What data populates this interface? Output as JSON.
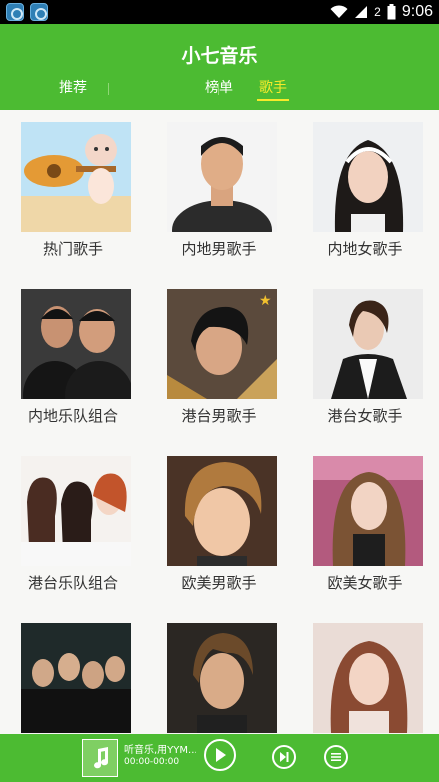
{
  "status_bar": {
    "time": "9:06",
    "signal_badge": "2"
  },
  "app": {
    "title": "小七音乐"
  },
  "tabs": [
    {
      "label": "推荐",
      "active": false
    },
    {
      "label": "榜单",
      "active": false
    },
    {
      "label": "歌手",
      "active": true
    }
  ],
  "categories": [
    {
      "label": "热门歌手"
    },
    {
      "label": "内地男歌手"
    },
    {
      "label": "内地女歌手"
    },
    {
      "label": "内地乐队组合"
    },
    {
      "label": "港台男歌手"
    },
    {
      "label": "港台女歌手"
    },
    {
      "label": "港台乐队组合"
    },
    {
      "label": "欧美男歌手"
    },
    {
      "label": "欧美女歌手"
    },
    {
      "label": ""
    },
    {
      "label": ""
    },
    {
      "label": ""
    }
  ],
  "player": {
    "song_title": "听音乐,用YYM...",
    "time": "00:00-00:00"
  },
  "colors": {
    "accent": "#4cbb32",
    "active_tab": "#f7ea2a"
  }
}
